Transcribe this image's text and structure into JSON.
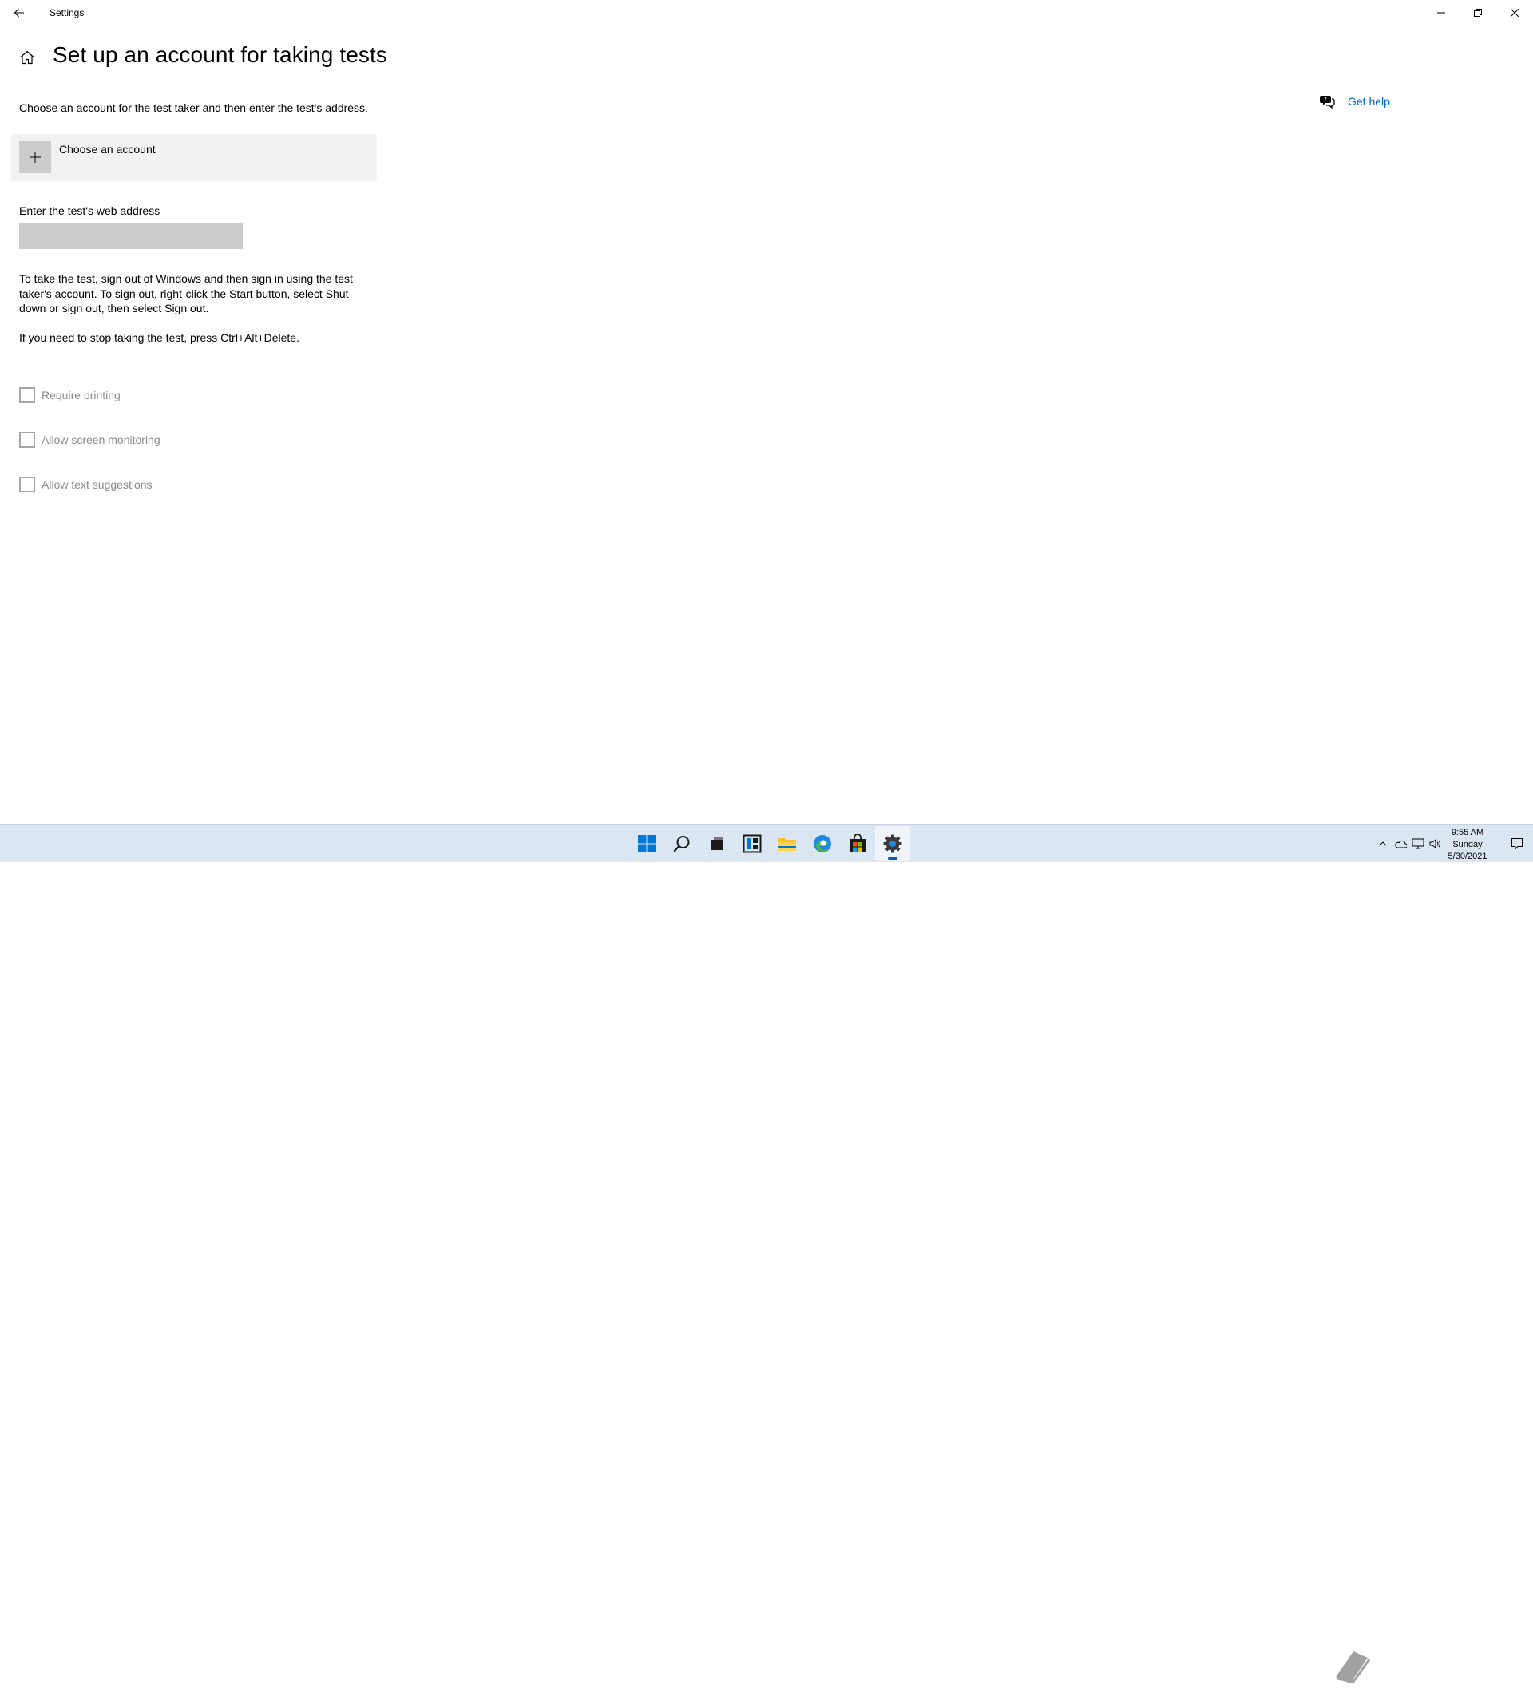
{
  "window": {
    "app_title": "Settings",
    "page_title": "Set up an account for taking tests"
  },
  "intro_text": "Choose an account for the test taker and then enter the test's address.",
  "choose_account": {
    "label": "Choose an account"
  },
  "address": {
    "label": "Enter the test's web address",
    "value": "",
    "placeholder": ""
  },
  "paragraphs": {
    "sign_out": "To take the test, sign out of Windows and then sign in using the test taker's account. To sign out, right-click the Start button, select Shut down or sign out, then select Sign out.",
    "stop": "If you need to stop taking the test, press Ctrl+Alt+Delete."
  },
  "options": [
    {
      "label": "Require printing",
      "checked": false
    },
    {
      "label": "Allow screen monitoring",
      "checked": false
    },
    {
      "label": "Allow text suggestions",
      "checked": false
    }
  ],
  "help": {
    "label": "Get help"
  },
  "taskbar": {
    "apps": [
      "start-icon",
      "search-icon",
      "task-view-icon",
      "widgets-icon",
      "file-explorer-icon",
      "edge-icon",
      "store-icon",
      "settings-icon"
    ],
    "active_app": "settings-icon",
    "clock": {
      "time": "9:55 AM",
      "day": "Sunday",
      "date": "5/30/2021"
    }
  },
  "colors": {
    "accent": "#0067c0",
    "taskbar": "#dbe6f3",
    "card": "#f2f2f2",
    "input": "#cccccc",
    "disabled_text": "#8a8a8a"
  }
}
